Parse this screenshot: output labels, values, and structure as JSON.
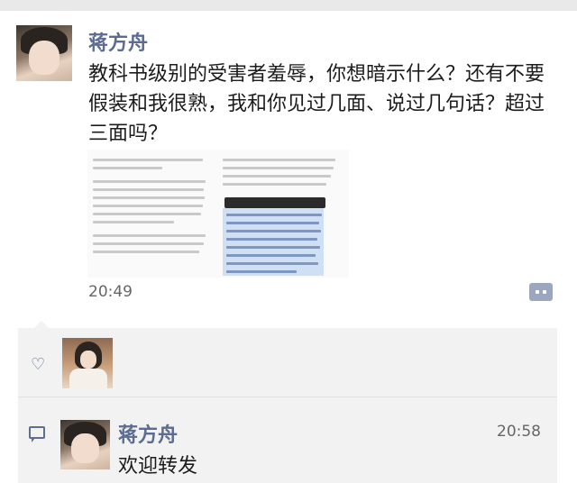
{
  "post": {
    "author": "蒋方舟",
    "text": "教科书级别的受害者羞辱，你想暗示什么？还有不要假装和我很熟，我和你见过几面、说过几句话？超过三面吗？",
    "time": "20:49"
  },
  "likes": {
    "icon": "heart-icon"
  },
  "comment": {
    "author": "蒋方舟",
    "time": "20:58",
    "text": "欢迎转发",
    "icon": "comment-icon"
  },
  "colors": {
    "name_blue": "#5b6b91",
    "highlight": "#cfe0f4",
    "panel_bg": "#f2f2f2"
  }
}
